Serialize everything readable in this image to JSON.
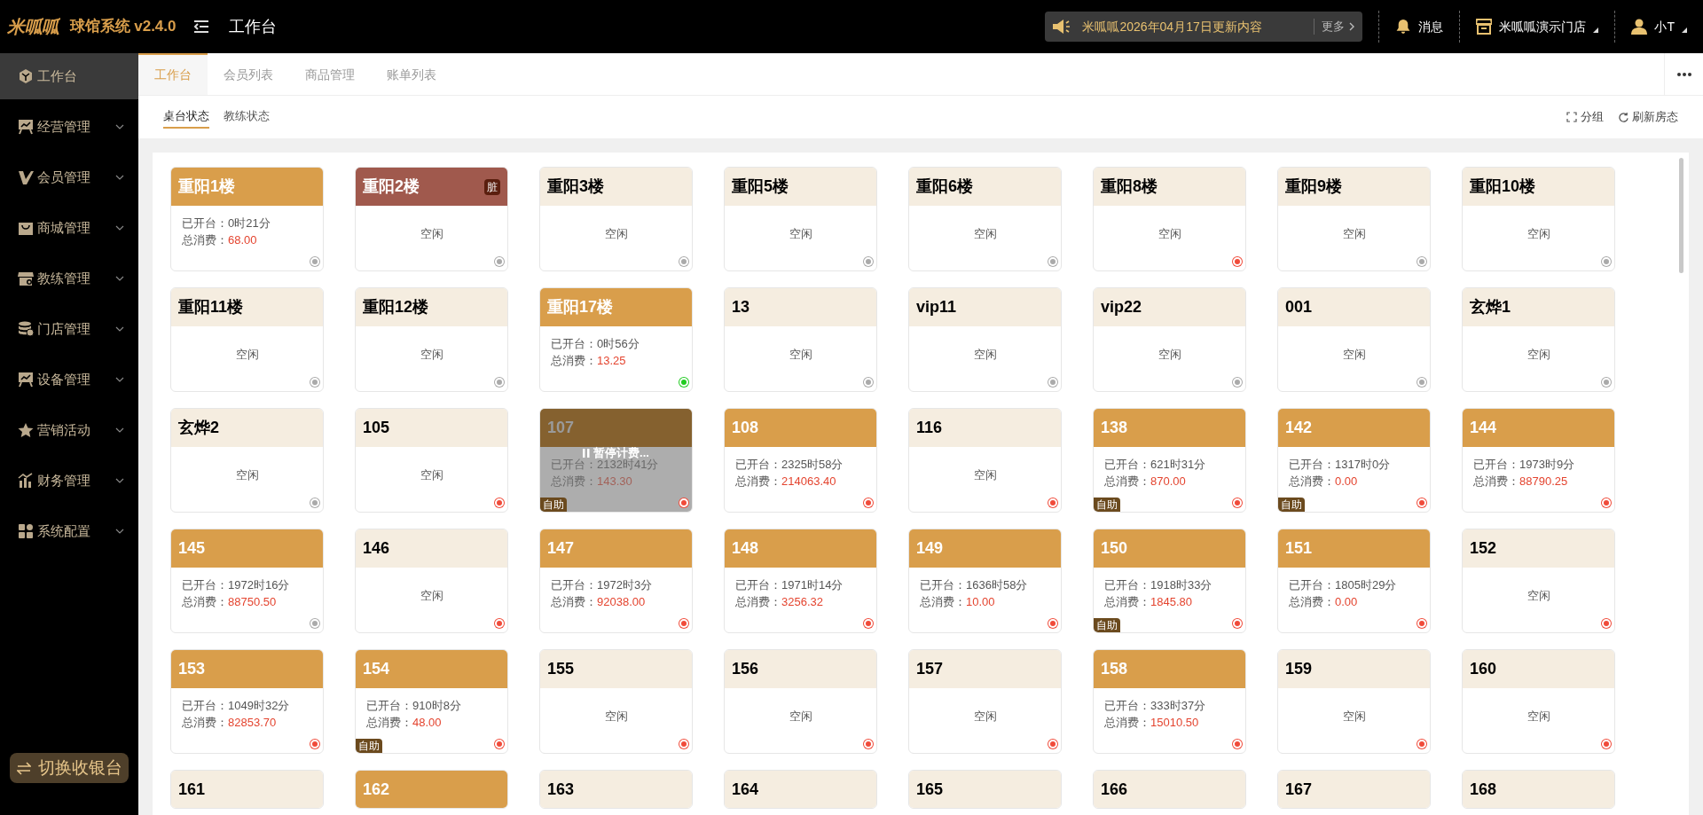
{
  "app": {
    "logo": "米呱呱",
    "title": "球馆系统 v2.4.0",
    "page": "工作台"
  },
  "notice": {
    "text": "米呱呱2026年04月17日更新内容",
    "more": "更多"
  },
  "header_actions": [
    {
      "label": "消息",
      "kind": "bell"
    },
    {
      "label": "米呱呱演示门店",
      "kind": "store"
    },
    {
      "label": "小T",
      "kind": "user"
    }
  ],
  "sidebar": {
    "items": [
      {
        "label": "工作台",
        "kind": "cube",
        "selected": true,
        "expandable": false
      },
      {
        "label": "经营管理",
        "kind": "board",
        "selected": false,
        "expandable": true
      },
      {
        "label": "会员管理",
        "kind": "v",
        "selected": false,
        "expandable": true
      },
      {
        "label": "商城管理",
        "kind": "bag",
        "selected": false,
        "expandable": true
      },
      {
        "label": "教练管理",
        "kind": "shop",
        "selected": false,
        "expandable": true
      },
      {
        "label": "门店管理",
        "kind": "coins",
        "selected": false,
        "expandable": true
      },
      {
        "label": "设备管理",
        "kind": "board",
        "selected": false,
        "expandable": true
      },
      {
        "label": "营销活动",
        "kind": "star",
        "selected": false,
        "expandable": true
      },
      {
        "label": "财务管理",
        "kind": "chart",
        "selected": false,
        "expandable": true
      },
      {
        "label": "系统配置",
        "kind": "grid",
        "selected": false,
        "expandable": true
      }
    ],
    "switch_button": "切换收银台"
  },
  "tabs": [
    {
      "label": "工作台",
      "selected": true
    },
    {
      "label": "会员列表",
      "selected": false
    },
    {
      "label": "商品管理",
      "selected": false
    },
    {
      "label": "账单列表",
      "selected": false
    }
  ],
  "subtabs": [
    {
      "label": "桌台状态",
      "selected": true
    },
    {
      "label": "教练状态",
      "selected": false
    }
  ],
  "toolbar": [
    {
      "label": "分组",
      "kind": "expand"
    },
    {
      "label": "刷新房态",
      "kind": "refresh"
    }
  ],
  "tables": [
    {
      "name": "重阳1楼",
      "kind": "open",
      "open_label": "已开台：",
      "open_time": "0时21分",
      "total_label": "总消费：",
      "total": "68.00",
      "color": "#aaaaaa"
    },
    {
      "name": "重阳2楼",
      "kind": "dirty",
      "status": "空闲",
      "badge": "脏",
      "color": "#aaaaaa"
    },
    {
      "name": "重阳3楼",
      "kind": "idle",
      "status": "空闲",
      "color": "#aaaaaa"
    },
    {
      "name": "重阳5楼",
      "kind": "idle",
      "status": "空闲",
      "color": "#aaaaaa"
    },
    {
      "name": "重阳6楼",
      "kind": "idle",
      "status": "空闲",
      "color": "#aaaaaa"
    },
    {
      "name": "重阳8楼",
      "kind": "idle",
      "status": "空闲",
      "color": "#f04b3a"
    },
    {
      "name": "重阳9楼",
      "kind": "idle",
      "status": "空闲",
      "color": "#aaaaaa"
    },
    {
      "name": "重阳10楼",
      "kind": "idle",
      "status": "空闲",
      "color": "#aaaaaa"
    },
    {
      "name": "重阳11楼",
      "kind": "idle",
      "status": "空闲",
      "color": "#aaaaaa"
    },
    {
      "name": "重阳12楼",
      "kind": "idle",
      "status": "空闲",
      "color": "#aaaaaa"
    },
    {
      "name": "重阳17楼",
      "kind": "open",
      "open_label": "已开台：",
      "open_time": "0时56分",
      "total_label": "总消费：",
      "total": "13.25",
      "color": "#22cc22"
    },
    {
      "name": "13",
      "kind": "idle",
      "status": "空闲",
      "color": "#aaaaaa"
    },
    {
      "name": "vip11",
      "kind": "idle",
      "status": "空闲",
      "color": "#aaaaaa"
    },
    {
      "name": "vip22",
      "kind": "idle",
      "status": "空闲",
      "color": "#aaaaaa"
    },
    {
      "name": "001",
      "kind": "idle",
      "status": "空闲",
      "color": "#aaaaaa"
    },
    {
      "name": "玄烨1",
      "kind": "idle",
      "status": "空闲",
      "color": "#aaaaaa"
    },
    {
      "name": "玄烨2",
      "kind": "idle",
      "status": "空闲",
      "color": "#aaaaaa"
    },
    {
      "name": "105",
      "kind": "idle",
      "status": "空闲",
      "color": "#f04b3a"
    },
    {
      "name": "107",
      "kind": "paused",
      "open_label": "已开台：",
      "open_time": "2132时41分",
      "total_label": "总消费：",
      "total": "143.30",
      "overlay": "暂停计费...",
      "tag": "自助",
      "color": "#f04b3a"
    },
    {
      "name": "108",
      "kind": "open",
      "open_label": "已开台：",
      "open_time": "2325时58分",
      "total_label": "总消费：",
      "total": "214063.40",
      "color": "#f04b3a"
    },
    {
      "name": "116",
      "kind": "idle",
      "status": "空闲",
      "color": "#f04b3a"
    },
    {
      "name": "138",
      "kind": "open",
      "open_label": "已开台：",
      "open_time": "621时31分",
      "total_label": "总消费：",
      "total": "870.00",
      "tag": "自助",
      "color": "#f04b3a"
    },
    {
      "name": "142",
      "kind": "open",
      "open_label": "已开台：",
      "open_time": "1317时0分",
      "total_label": "总消费：",
      "total": "0.00",
      "tag": "自助",
      "color": "#f04b3a"
    },
    {
      "name": "144",
      "kind": "open",
      "open_label": "已开台：",
      "open_time": "1973时9分",
      "total_label": "总消费：",
      "total": "88790.25",
      "color": "#f04b3a"
    },
    {
      "name": "145",
      "kind": "open",
      "open_label": "已开台：",
      "open_time": "1972时16分",
      "total_label": "总消费：",
      "total": "88750.50",
      "color": "#aaaaaa"
    },
    {
      "name": "146",
      "kind": "idle",
      "status": "空闲",
      "color": "#f04b3a"
    },
    {
      "name": "147",
      "kind": "open",
      "open_label": "已开台：",
      "open_time": "1972时3分",
      "total_label": "总消费：",
      "total": "92038.00",
      "color": "#f04b3a"
    },
    {
      "name": "148",
      "kind": "open",
      "open_label": "已开台：",
      "open_time": "1971时14分",
      "total_label": "总消费：",
      "total": "3256.32",
      "color": "#f04b3a"
    },
    {
      "name": "149",
      "kind": "open",
      "open_label": "已开台：",
      "open_time": "1636时58分",
      "total_label": "总消费：",
      "total": "10.00",
      "color": "#f04b3a"
    },
    {
      "name": "150",
      "kind": "open",
      "open_label": "已开台：",
      "open_time": "1918时33分",
      "total_label": "总消费：",
      "total": "1845.80",
      "tag": "自助",
      "color": "#f04b3a"
    },
    {
      "name": "151",
      "kind": "open",
      "open_label": "已开台：",
      "open_time": "1805时29分",
      "total_label": "总消费：",
      "total": "0.00",
      "color": "#f04b3a"
    },
    {
      "name": "152",
      "kind": "idle",
      "status": "空闲",
      "color": "#f04b3a"
    },
    {
      "name": "153",
      "kind": "open",
      "open_label": "已开台：",
      "open_time": "1049时32分",
      "total_label": "总消费：",
      "total": "82853.70",
      "color": "#f04b3a"
    },
    {
      "name": "154",
      "kind": "open",
      "open_label": "已开台：",
      "open_time": "910时8分",
      "total_label": "总消费：",
      "total": "48.00",
      "tag": "自助",
      "color": "#f04b3a"
    },
    {
      "name": "155",
      "kind": "idle",
      "status": "空闲",
      "color": "#f04b3a"
    },
    {
      "name": "156",
      "kind": "idle",
      "status": "空闲",
      "color": "#f04b3a"
    },
    {
      "name": "157",
      "kind": "idle",
      "status": "空闲",
      "color": "#f04b3a"
    },
    {
      "name": "158",
      "kind": "open",
      "open_label": "已开台：",
      "open_time": "333时37分",
      "total_label": "总消费：",
      "total": "15010.50",
      "color": "#f04b3a"
    },
    {
      "name": "159",
      "kind": "idle",
      "status": "空闲",
      "color": "#f04b3a"
    },
    {
      "name": "160",
      "kind": "idle",
      "status": "空闲",
      "color": "#f04b3a"
    },
    {
      "name": "161",
      "kind": "idle_cut"
    },
    {
      "name": "162",
      "kind": "open_cut"
    },
    {
      "name": "163",
      "kind": "idle_cut"
    },
    {
      "name": "164",
      "kind": "idle_cut"
    },
    {
      "name": "165",
      "kind": "idle_cut"
    },
    {
      "name": "166",
      "kind": "idle_cut"
    },
    {
      "name": "167",
      "kind": "idle_cut"
    },
    {
      "name": "168",
      "kind": "idle_cut"
    }
  ]
}
